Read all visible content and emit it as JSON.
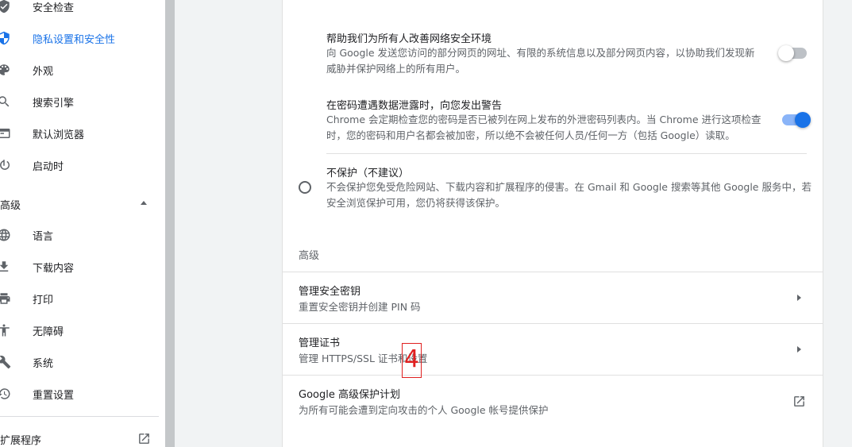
{
  "sidebar": {
    "items": [
      {
        "label": "安全检查",
        "icon": "shield-check-icon"
      },
      {
        "label": "隐私设置和安全性",
        "icon": "privacy-shield-icon",
        "active": true
      },
      {
        "label": "外观",
        "icon": "palette-icon"
      },
      {
        "label": "搜索引擎",
        "icon": "search-icon"
      },
      {
        "label": "默认浏览器",
        "icon": "browser-window-icon"
      },
      {
        "label": "启动时",
        "icon": "power-icon"
      }
    ],
    "advanced_header": "高级",
    "advanced_items": [
      {
        "label": "语言",
        "icon": "globe-icon"
      },
      {
        "label": "下载内容",
        "icon": "download-icon"
      },
      {
        "label": "打印",
        "icon": "printer-icon"
      },
      {
        "label": "无障碍",
        "icon": "accessibility-icon"
      },
      {
        "label": "系统",
        "icon": "wrench-icon"
      },
      {
        "label": "重置设置",
        "icon": "restore-icon"
      }
    ],
    "extensions_label": "扩展程序"
  },
  "main": {
    "improve_security": {
      "title": "帮助我们为所有人改善网络安全环境",
      "desc": "向 Google 发送您访问的部分网页的网址、有限的系统信息以及部分网页内容，以协助我们发现新威胁并保护网络上的所有用户。",
      "enabled": false
    },
    "password_leak": {
      "title": "在密码遭遇数据泄露时，向您发出警告",
      "desc": "Chrome 会定期检查您的密码是否已被列在网上发布的外泄密码列表内。当 Chrome 进行这项检查时，您的密码和用户名都会被加密，所以绝不会被任何人员/任何一方（包括 Google）读取。",
      "enabled": true
    },
    "no_protection": {
      "title": "不保护（不建议）",
      "desc": "不会保护您免受危险网站、下载内容和扩展程序的侵害。在 Gmail 和 Google 搜索等其他 Google 服务中，若安全浏览保护可用，您仍将获得该保护。"
    },
    "advanced_label": "高级",
    "rows": [
      {
        "title": "管理安全密钥",
        "desc": "重置安全密钥并创建 PIN 码"
      },
      {
        "title": "管理证书",
        "desc": "管理 HTTPS/SSL 证书和设置"
      },
      {
        "title": "Google 高级保护计划",
        "desc": "为所有可能会遭到定向攻击的个人 Google 帐号提供保护"
      }
    ]
  },
  "annotation": {
    "marker": "4"
  },
  "colors": {
    "accent": "#1a73e8",
    "marker": "#e02020"
  }
}
